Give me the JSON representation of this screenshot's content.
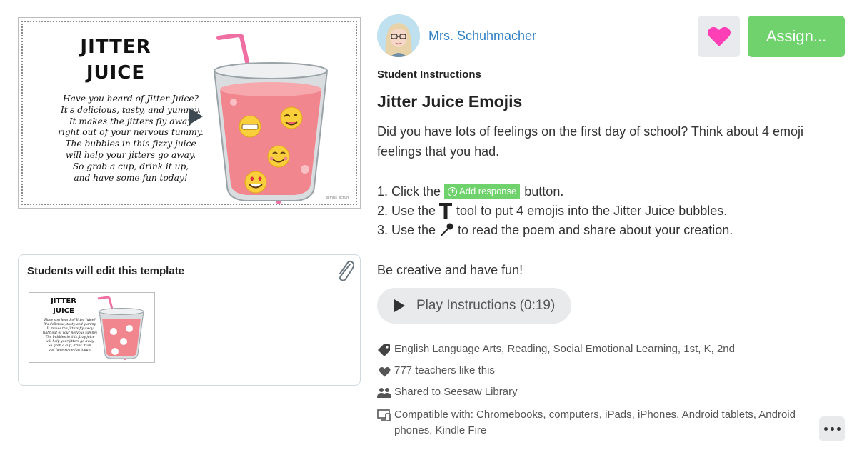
{
  "preview": {
    "poem_title_line1": "JITTER",
    "poem_title_line2": "JUICE",
    "poem_lines": [
      "Have you heard of Jitter Juice?",
      "It's delicious, tasty, and yummy.",
      "It makes the jitters fly away",
      "right out of your nervous tummy.",
      "The bubbles in this fizzy juice",
      "will help your jitters go away.",
      "So grab a cup, drink it up,",
      "and have some fun today!"
    ],
    "credit": "@miss_schuh"
  },
  "template": {
    "title": "Students will edit this template"
  },
  "teacher": {
    "name": "Mrs. Schuhmacher"
  },
  "actions": {
    "assign_label": "Assign..."
  },
  "instructions": {
    "section_label": "Student Instructions",
    "title": "Jitter Juice Emojis",
    "intro": "Did you have lots of feelings on the first day of school? Think about 4 emoji feelings that you had.",
    "step1_before": "1. Click the",
    "add_response_label": "Add response",
    "step1_after": "button.",
    "step2_before": "2. Use the",
    "step2_after": "tool to put 4 emojis into the Jitter Juice bubbles.",
    "step3_before": "3. Use the",
    "step3_after": "to read the poem and share about your creation.",
    "closing": "Be creative and have fun!",
    "play_label": "Play Instructions (0:19)"
  },
  "meta": {
    "tags": "English Language Arts, Reading, Social Emotional Learning, 1st, K, 2nd",
    "likes": "777 teachers like this",
    "shared": "Shared to Seesaw Library",
    "compatible": "Compatible with: Chromebooks, computers, iPads, iPhones, Android tablets, Android phones, Kindle Fire"
  },
  "colors": {
    "accent_green": "#6fd26c",
    "link_blue": "#2f80c4",
    "heart_pink": "#ff3fb5"
  }
}
